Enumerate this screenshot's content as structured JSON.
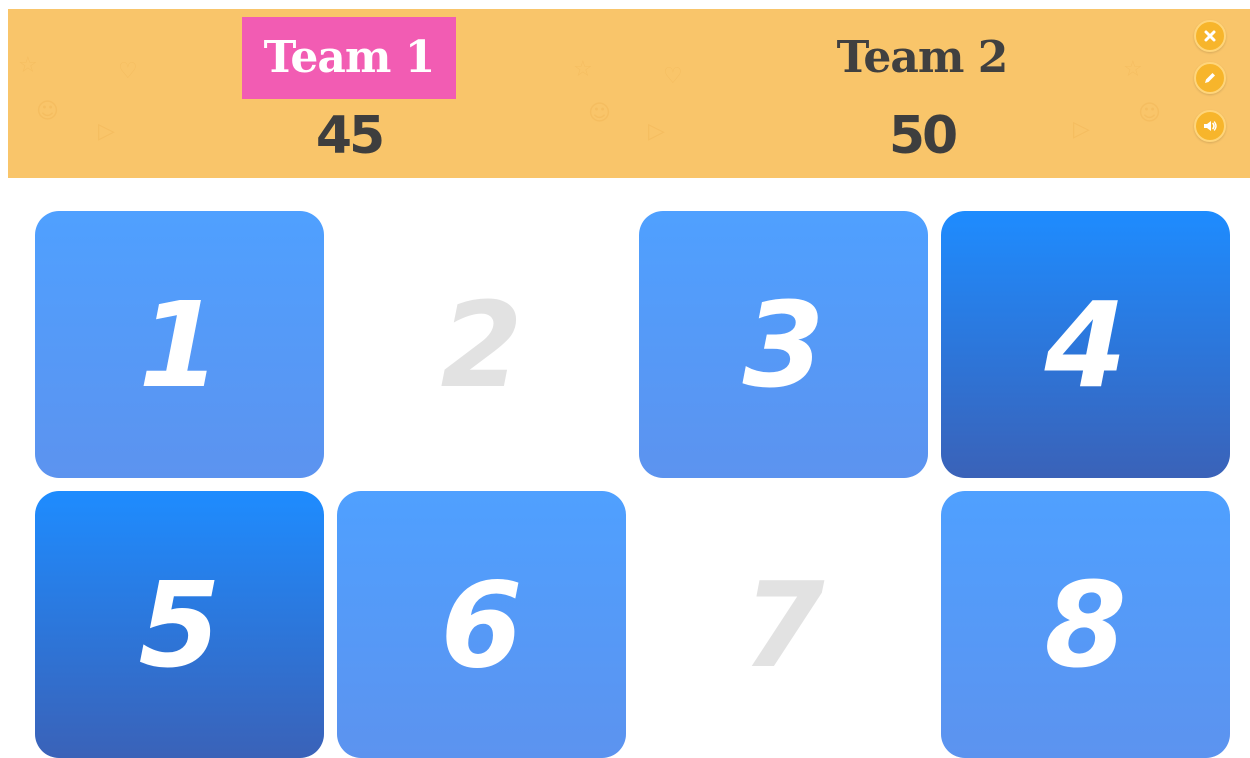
{
  "scoreboard": {
    "teams": [
      {
        "name": "Team 1",
        "score": "45",
        "active": true
      },
      {
        "name": "Team 2",
        "score": "50",
        "active": false
      }
    ],
    "controls": [
      {
        "icon": "close-icon"
      },
      {
        "icon": "edit-pencil-icon"
      },
      {
        "icon": "sound-icon"
      }
    ],
    "colors": {
      "bar": "#f9c56a",
      "active_team": "#f25cb3",
      "control": "#f7b52b"
    }
  },
  "tiles": [
    {
      "number": "1",
      "state": "light"
    },
    {
      "number": "2",
      "state": "revealed"
    },
    {
      "number": "3",
      "state": "light"
    },
    {
      "number": "4",
      "state": "dark"
    },
    {
      "number": "5",
      "state": "dark"
    },
    {
      "number": "6",
      "state": "light"
    },
    {
      "number": "7",
      "state": "revealed"
    },
    {
      "number": "8",
      "state": "light"
    }
  ]
}
